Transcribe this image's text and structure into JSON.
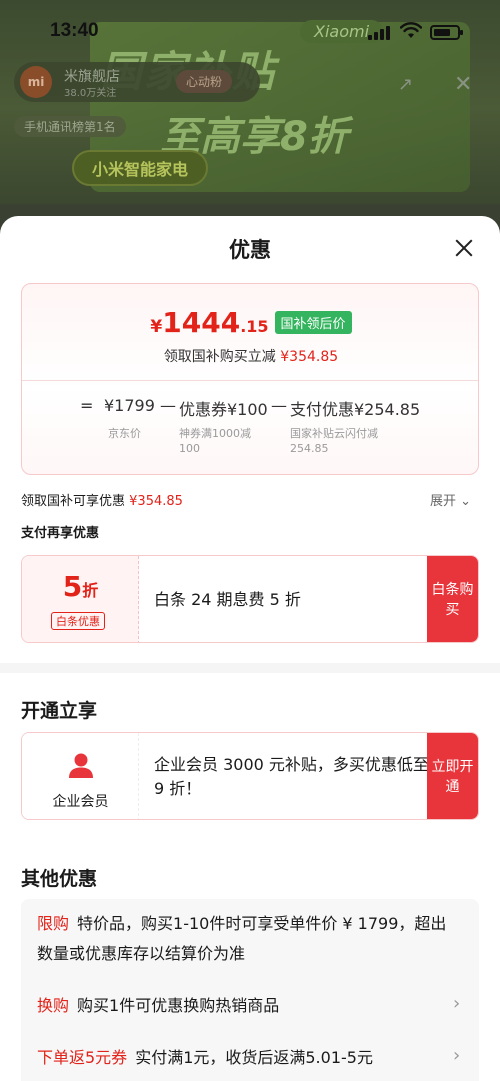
{
  "status_bar": {
    "time": "13:40"
  },
  "background": {
    "banner_title": "国家补贴",
    "banner_subtitle": "至高享8折",
    "brand_tag": "Xiaomi",
    "category": "小米智能家电",
    "shop_logo": "mi",
    "shop_name": "米旗舰店",
    "shop_fans": "38.0万关注",
    "follow_label": "心动粉",
    "rank_label": "手机通讯榜第1名"
  },
  "sheet": {
    "title": "优惠",
    "price_card": {
      "currency": "¥",
      "price_integer": "1444",
      "price_decimal": ".15",
      "price_tag": "国补领后价",
      "subtitle_prefix": "领取国补购买立减",
      "subtitle_amount": "¥354.85",
      "formula": {
        "equals": "=",
        "base_price": "¥1799",
        "minus1": "—",
        "coupon": "优惠券¥100",
        "minus2": "—",
        "payment": "支付优惠¥254.85"
      },
      "notes": {
        "base": "京东价",
        "coupon": "神券满1000减100",
        "payment": "国家补贴云闪付减254.85"
      }
    },
    "subsidy_row": {
      "label": "领取国补可享优惠",
      "amount": "¥354.85",
      "expand": "展开"
    },
    "pay_section_title": "支付再享优惠",
    "baitiao_offer": {
      "discount_number": "5",
      "discount_unit": "折",
      "discount_tag": "白条优惠",
      "text": "白条 24 期息费 5 折",
      "button": "白条购买"
    },
    "open_section_title": "开通立享",
    "member_offer": {
      "icon": "user-icon",
      "label": "企业会员",
      "text": "企业会员 3000 元补贴，多买优惠低至 9 折！",
      "button": "立即开通"
    },
    "other_section_title": "其他优惠",
    "other_items": [
      {
        "tag": "限购",
        "text": "特价品，购买1-10件时可享受单件价 ¥ 1799，超出数量或优惠库存以结算价为准"
      },
      {
        "tag": "换购",
        "text": "购买1件可优惠换购热销商品"
      },
      {
        "tag": "下单返5元券",
        "text": "实付满1元，收货后返满5.01-5元"
      }
    ]
  },
  "colors": {
    "accent": "#e2231a",
    "button": "#e8343b",
    "tag_green": "#34b45e"
  }
}
